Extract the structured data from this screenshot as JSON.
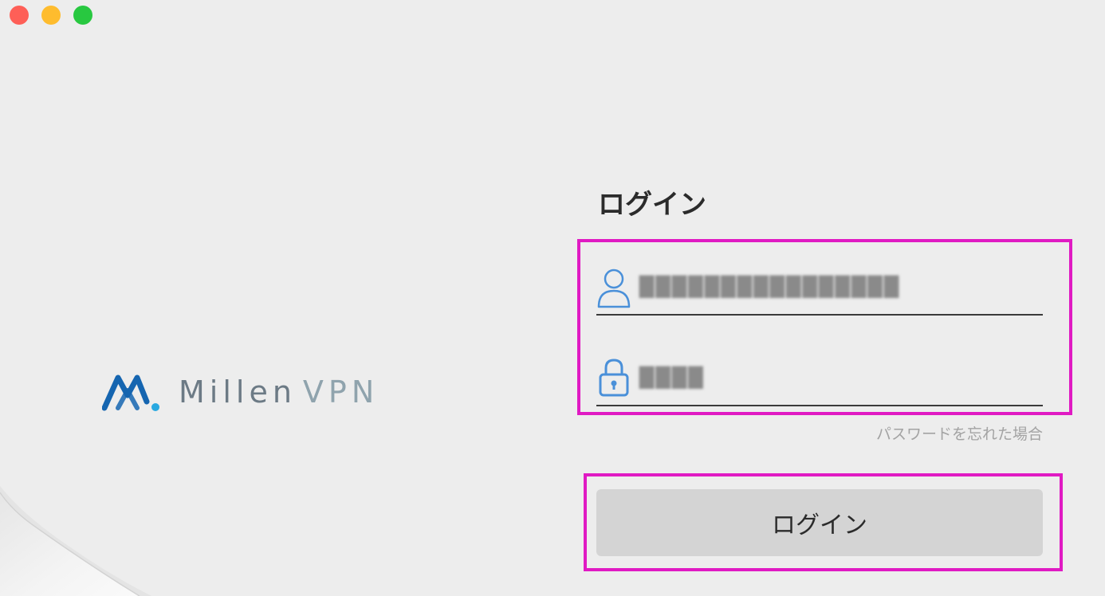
{
  "window": {
    "controls": [
      "close",
      "minimize",
      "maximize"
    ]
  },
  "logo": {
    "name_part1": "Millen",
    "name_part2": "VPN",
    "icon": "millen-mountain-logo",
    "colors": {
      "mark_dark": "#1565b0",
      "mark_light": "#29a8e0",
      "text": "#6c7a85",
      "text_vpn": "#8fa3ad"
    }
  },
  "login": {
    "title": "ログイン",
    "username": {
      "value": "████████████████",
      "icon": "user-icon"
    },
    "password": {
      "value": "████",
      "icon": "lock-icon"
    },
    "forgot_link": "パスワードを忘れた場合",
    "submit_label": "ログイン"
  },
  "colors": {
    "background": "#ededed",
    "highlight": "#e01ac3",
    "icon_blue": "#4a90d9",
    "button_bg": "#d4d4d4"
  }
}
